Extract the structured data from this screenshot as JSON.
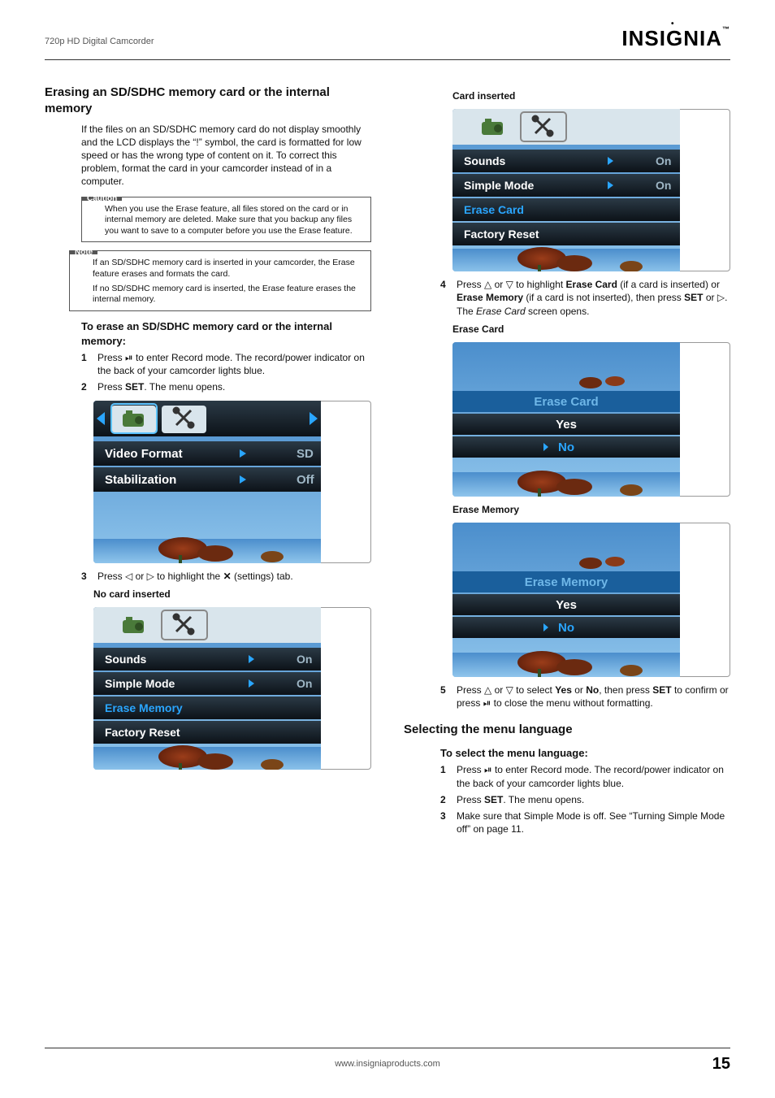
{
  "header": {
    "left": "720p HD Digital Camcorder",
    "logo": "INSIGNIA",
    "logo_tm": "™"
  },
  "section1": {
    "title": "Erasing an SD/SDHC memory card or the internal memory",
    "intro": "If the files on an SD/SDHC memory card do not display smoothly and the LCD displays the “!” symbol, the card is formatted for low speed or has the wrong type of content on it. To correct this problem, format the card in your camcorder instead of in a computer.",
    "caution_label": "Caution",
    "caution_text": "When you use the Erase feature, all files stored on the card or in internal memory are deleted. Make sure that you backup any files you want to save to a computer before you use the Erase feature.",
    "note_label": "Note",
    "note_text1": "If an SD/SDHC memory card is inserted in your camcorder, the Erase feature erases and formats the card.",
    "note_text2": "If no SD/SDHC memory card is inserted, the Erase feature erases the internal memory.",
    "proc_heading": "To erase an SD/SDHC memory card or the internal memory:",
    "step1_pre": "Press ",
    "step1_post": " to enter Record mode. The record/power indicator on the back of your camcorder lights blue.",
    "step2_a": "Press ",
    "step2_b": "SET",
    "step2_c": ". The menu opens.",
    "step3_a": "Press ",
    "step3_b": " or ",
    "step3_c": " to highlight the ",
    "step3_d": " (settings) tab.",
    "no_card_label": "No card inserted",
    "card_label": "Card inserted",
    "step4_a": "Press ",
    "step4_b": " or ",
    "step4_c": " to highlight ",
    "step4_d": "Erase Card",
    "step4_e": " (if a card is inserted) or ",
    "step4_f": "Erase Memory",
    "step4_g": " (if a card is not inserted), then press ",
    "step4_h": "SET",
    "step4_i": " or ",
    "step4_j": ". The ",
    "step4_k": "Erase Card",
    "step4_l": " screen opens.",
    "erase_card_label": "Erase Card",
    "erase_memory_label": "Erase Memory",
    "step5_a": "Press ",
    "step5_b": " or ",
    "step5_c": " to select ",
    "step5_d": "Yes",
    "step5_e": " or ",
    "step5_f": "No",
    "step5_g": ", then press ",
    "step5_h": "SET",
    "step5_i": " to confirm or press ",
    "step5_j": " to close the menu without formatting."
  },
  "section2": {
    "title": "Selecting the menu language",
    "proc_heading": "To select the menu language:",
    "step1_pre": "Press ",
    "step1_post": " to enter Record mode. The record/power indicator on the back of your camcorder lights blue.",
    "step2_a": "Press ",
    "step2_b": "SET",
    "step2_c": ". The menu opens.",
    "step3": "Make sure that Simple Mode is off. See “Turning Simple Mode off” on page 11."
  },
  "footer": {
    "url": "www.insigniaproducts.com",
    "page": "15"
  },
  "lcd_menu_main": {
    "row1_label": "Video Format",
    "row1_val": "SD",
    "row2_label": "Stabilization",
    "row2_val": "Off"
  },
  "lcd_settings_nocard": {
    "r1": "Sounds",
    "v1": "On",
    "r2": "Simple Mode",
    "v2": "On",
    "r3": "Erase Memory",
    "r4": "Factory Reset"
  },
  "lcd_settings_card": {
    "r1": "Sounds",
    "v1": "On",
    "r2": "Simple Mode",
    "v2": "On",
    "r3": "Erase Card",
    "r4": "Factory Reset"
  },
  "lcd_erase_card": {
    "title": "Erase Card",
    "yes": "Yes",
    "no": "No"
  },
  "lcd_erase_memory": {
    "title": "Erase Memory",
    "yes": "Yes",
    "no": "No"
  }
}
